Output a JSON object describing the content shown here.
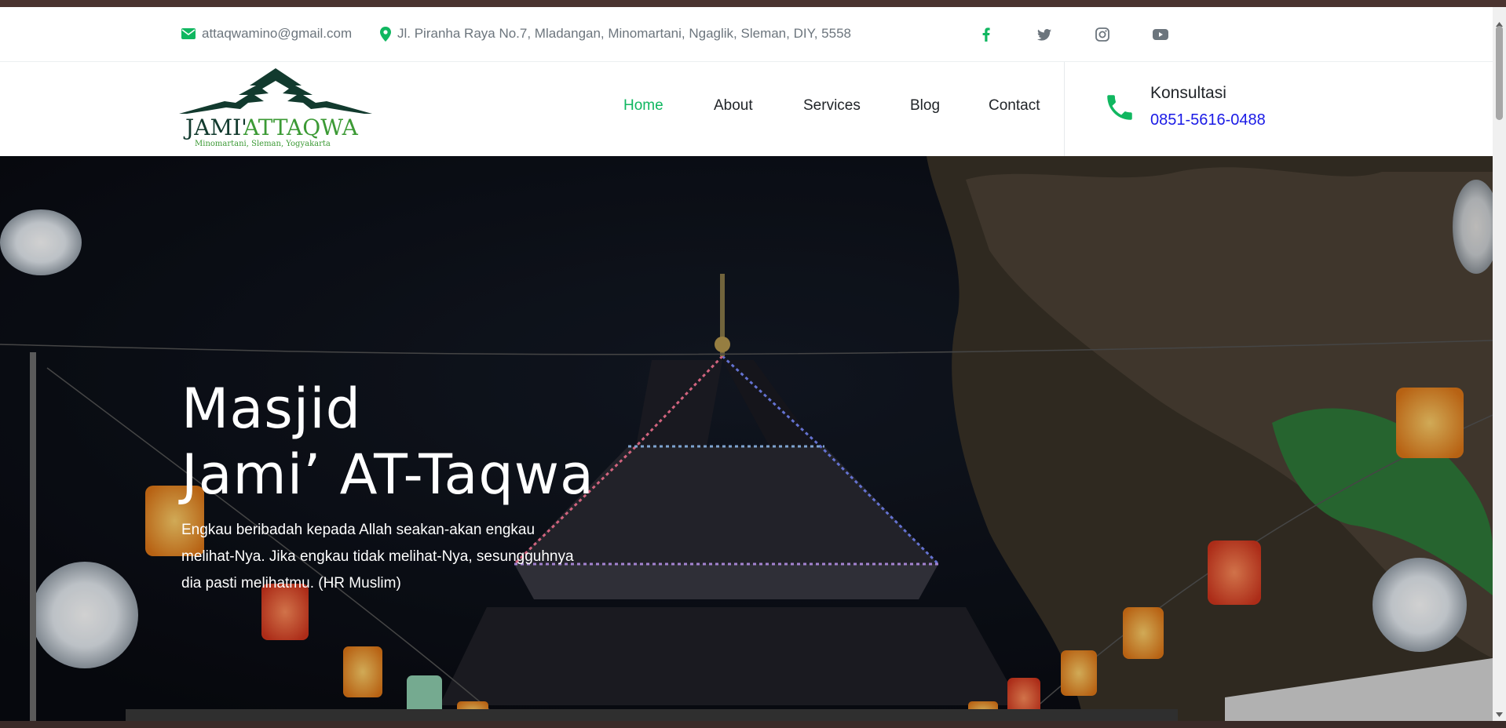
{
  "topbar": {
    "email": "attaqwamino@gmail.com",
    "address": "Jl. Piranha Raya No.7, Mladangan, Minomartani, Ngaglik, Sleman, DIY, 5558",
    "social": [
      "facebook-icon",
      "twitter-icon",
      "instagram-icon",
      "youtube-icon"
    ]
  },
  "logo": {
    "name_part1": "JAMI'",
    "name_part2": "ATTAQWA",
    "tagline": "Minomartani, Sleman, Yogyakarta"
  },
  "nav": {
    "items": [
      {
        "label": "Home",
        "active": true
      },
      {
        "label": "About",
        "active": false
      },
      {
        "label": "Services",
        "active": false
      },
      {
        "label": "Blog",
        "active": false
      },
      {
        "label": "Contact",
        "active": false
      }
    ]
  },
  "consult": {
    "label": "Konsultasi",
    "phone": "0851-5616-0488"
  },
  "hero": {
    "title_line1": "Masjid",
    "title_line2": "Jami’ AT-Taqwa",
    "text": "Engkau beribadah kepada Allah seakan-akan engkau melihat-Nya. Jika engkau tidak melihat-Nya, sesungguhnya dia pasti melihatmu. (HR Muslim)"
  },
  "colors": {
    "accent": "#10b760",
    "phone_link": "#1a1ae6",
    "logo_dark": "#123a2e",
    "logo_green": "#3c9a35"
  }
}
